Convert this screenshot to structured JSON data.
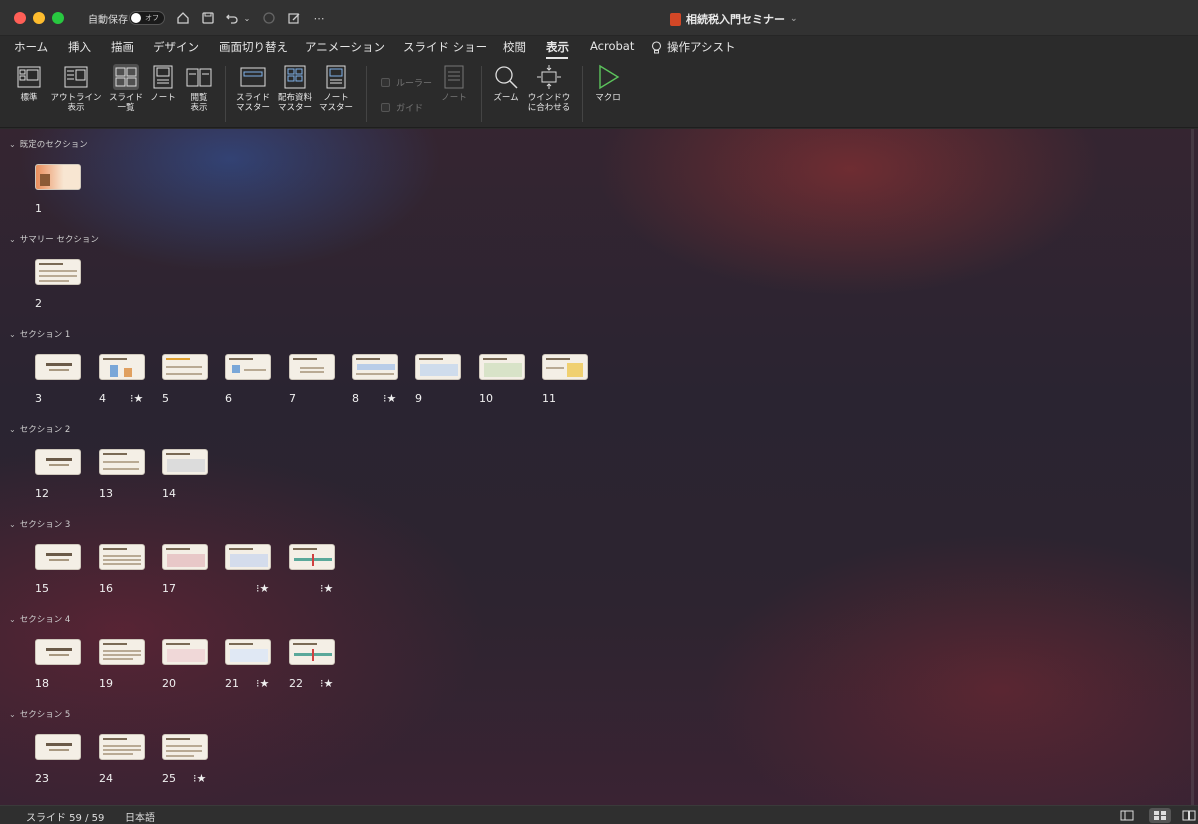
{
  "titlebar": {
    "autosave_label": "自動保存",
    "autosave_state": "オフ",
    "doc_title": "相続税入門セミナー",
    "quick_access": [
      "home-icon",
      "save-icon",
      "undo-icon",
      "undo-dropdown-icon",
      "redo-icon",
      "edit-icon",
      "more-icon"
    ]
  },
  "tabs": [
    {
      "label": "ホーム",
      "active": false
    },
    {
      "label": "挿入",
      "active": false
    },
    {
      "label": "描画",
      "active": false
    },
    {
      "label": "デザイン",
      "active": false
    },
    {
      "label": "画面切り替え",
      "active": false
    },
    {
      "label": "アニメーション",
      "active": false
    },
    {
      "label": "スライド ショー",
      "active": false
    },
    {
      "label": "校閲",
      "active": false
    },
    {
      "label": "表示",
      "active": true
    },
    {
      "label": "Acrobat",
      "active": false
    },
    {
      "label": "操作アシスト",
      "active": false
    }
  ],
  "ribbon": {
    "normal": {
      "line1": "標準",
      "line2": ""
    },
    "outline": {
      "line1": "アウトライン",
      "line2": "表示"
    },
    "sorter": {
      "line1": "スライド",
      "line2": "一覧"
    },
    "notes": {
      "line1": "ノート",
      "line2": ""
    },
    "reading": {
      "line1": "閲覧",
      "line2": "表示"
    },
    "slide_master": {
      "line1": "スライド",
      "line2": "マスター"
    },
    "handout_master": {
      "line1": "配布資料",
      "line2": "マスター"
    },
    "notes_master": {
      "line1": "ノート",
      "line2": "マスター"
    },
    "ruler": "ルーラー",
    "guides": "ガイド",
    "notes_disabled": "ノート",
    "zoom": {
      "line1": "ズーム",
      "line2": ""
    },
    "fit": {
      "line1": "ウインドウ",
      "line2": "に合わせる"
    },
    "macro": {
      "line1": "マクロ",
      "line2": ""
    }
  },
  "sections": [
    {
      "name": "既定のセクション",
      "slides": [
        {
          "n": "1",
          "star": false
        }
      ]
    },
    {
      "name": "サマリー セクション",
      "slides": [
        {
          "n": "2",
          "star": false
        }
      ]
    },
    {
      "name": "セクション 1",
      "slides": [
        {
          "n": "3",
          "star": false
        },
        {
          "n": "4",
          "star": true
        },
        {
          "n": "5",
          "star": false
        },
        {
          "n": "6",
          "star": false
        },
        {
          "n": "7",
          "star": false
        },
        {
          "n": "8",
          "star": true
        },
        {
          "n": "9",
          "star": false
        },
        {
          "n": "10",
          "star": false
        },
        {
          "n": "11",
          "star": false
        }
      ]
    },
    {
      "name": "セクション 2",
      "slides": [
        {
          "n": "12",
          "star": false
        },
        {
          "n": "13",
          "star": false
        },
        {
          "n": "14",
          "star": false
        }
      ]
    },
    {
      "name": "セクション 3",
      "slides": [
        {
          "n": "15",
          "star": false
        },
        {
          "n": "16",
          "star": false
        },
        {
          "n": "17",
          "star": false
        }
      ]
    },
    {
      "name": "セクション 4",
      "slides": [
        {
          "n": "18",
          "star": false
        },
        {
          "n": "19",
          "star": false
        },
        {
          "n": "20",
          "star": false
        },
        {
          "n": "21",
          "star": true
        },
        {
          "n": "22",
          "star": true
        }
      ]
    },
    {
      "name": "セクション 5",
      "slides": [
        {
          "n": "23",
          "star": false
        },
        {
          "n": "24",
          "star": false
        },
        {
          "n": "25",
          "star": true
        }
      ]
    }
  ],
  "star_glyph": "⁝★",
  "status": {
    "slide_text": "スライド 59 / 59",
    "language": "日本語"
  }
}
